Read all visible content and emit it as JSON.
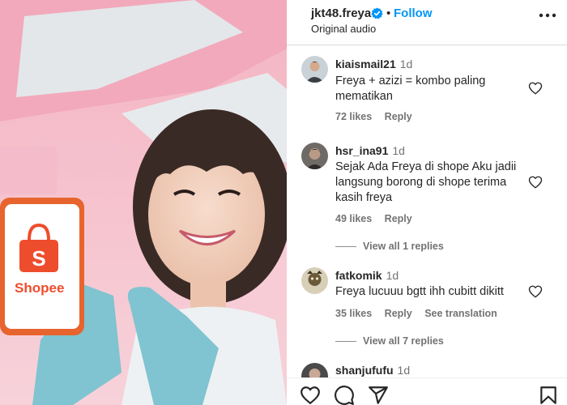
{
  "post": {
    "username": "jkt48.freya",
    "separator": "•",
    "follow_label": "Follow",
    "audio": "Original audio"
  },
  "media": {
    "brand_text": "Shopee",
    "brand_color": "#ee4d2d"
  },
  "comments": [
    {
      "user": "kiaismail21",
      "time": "1d",
      "text": "Freya + azizi = kombo paling mematikan",
      "likes": "72 likes",
      "reply": "Reply"
    },
    {
      "user": "hsr_ina91",
      "time": "1d",
      "text": "Sejak Ada Freya di shope Aku jadii langsung borong di shope terima kasih freya",
      "likes": "49 likes",
      "reply": "Reply",
      "view_replies": "View all 1 replies"
    },
    {
      "user": "fatkomik",
      "time": "1d",
      "text": "Freya lucuuu bgtt ihh cubitt dikitt",
      "likes": "35 likes",
      "reply": "Reply",
      "translate": "See translation",
      "view_replies": "View all 7 replies"
    },
    {
      "user": "shanjufufu",
      "time": "1d"
    }
  ],
  "icons": {
    "like": "heart-icon",
    "comment": "comment-icon",
    "share": "share-icon",
    "save": "bookmark-icon",
    "verified": "verified-badge-icon",
    "more": "more-options-icon"
  },
  "colors": {
    "accent": "#0095f6",
    "verified": "#0095f6",
    "secondary_text": "#737373"
  }
}
